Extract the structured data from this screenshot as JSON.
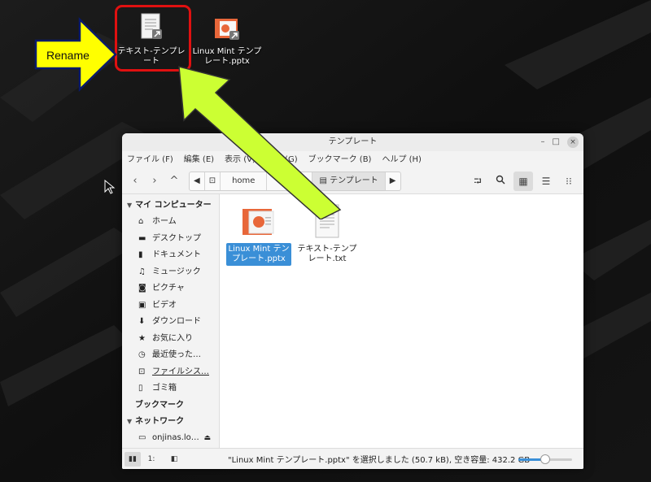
{
  "desktop": {
    "icons": [
      {
        "label": "テキスト-テンプレート",
        "icon": "text-document-link-icon"
      },
      {
        "label": "Linux Mint テンプレート.pptx",
        "icon": "presentation-link-icon"
      }
    ],
    "annotation": {
      "label": "Rename",
      "frame_color": "#e01010",
      "callout_color": "#ffff00",
      "arrow_color": "#ccff33"
    }
  },
  "window": {
    "title": "テンプレート",
    "controls": {
      "minimize": "–",
      "maximize": "□",
      "close": "×"
    },
    "menu": [
      "ファイル (F)",
      "編集 (E)",
      "表示 (V)",
      "移動 (G)",
      "ブックマーク (B)",
      "ヘルプ (H)"
    ],
    "nav": {
      "back": "‹",
      "forward": "›",
      "up": "^"
    },
    "path": {
      "prev": "◀",
      "root": "⊡",
      "home": "home",
      "user": "",
      "current": "テンプレート",
      "next": "▶"
    },
    "toolbar_right": {
      "open_terminal": "⮒",
      "search": "🔍",
      "icons_view": "▦",
      "list_view": "☰",
      "compact_view": "⁝⁝"
    },
    "sidebar": {
      "computer_header": "マイ コンピューター",
      "computer_items": [
        {
          "label": "ホーム",
          "icon": "home-icon"
        },
        {
          "label": "デスクトップ",
          "icon": "desktop-icon"
        },
        {
          "label": "ドキュメント",
          "icon": "document-icon"
        },
        {
          "label": "ミュージック",
          "icon": "music-icon"
        },
        {
          "label": "ピクチャ",
          "icon": "camera-icon"
        },
        {
          "label": "ビデオ",
          "icon": "film-icon"
        },
        {
          "label": "ダウンロード",
          "icon": "download-icon"
        },
        {
          "label": "お気に入り",
          "icon": "star-icon"
        },
        {
          "label": "最近使った…",
          "icon": "clock-icon"
        },
        {
          "label": "ファイルシス…",
          "icon": "drive-icon"
        },
        {
          "label": "ゴミ箱",
          "icon": "trash-icon"
        }
      ],
      "bookmarks_header": "ブックマーク",
      "network_header": "ネットワーク",
      "network_items": [
        {
          "label": "onjinas.lo…",
          "icon": "network-folder-icon"
        }
      ]
    },
    "files": [
      {
        "name": "Linux Mint テンプレート.pptx",
        "selected": true
      },
      {
        "name": "テキスト-テンプレート.txt",
        "selected": false
      }
    ],
    "status": "\"Linux Mint テンプレート.pptx\" を選択しました (50.7 kB), 空き容量: 432.2 GB",
    "zoom_level": 0.5
  }
}
